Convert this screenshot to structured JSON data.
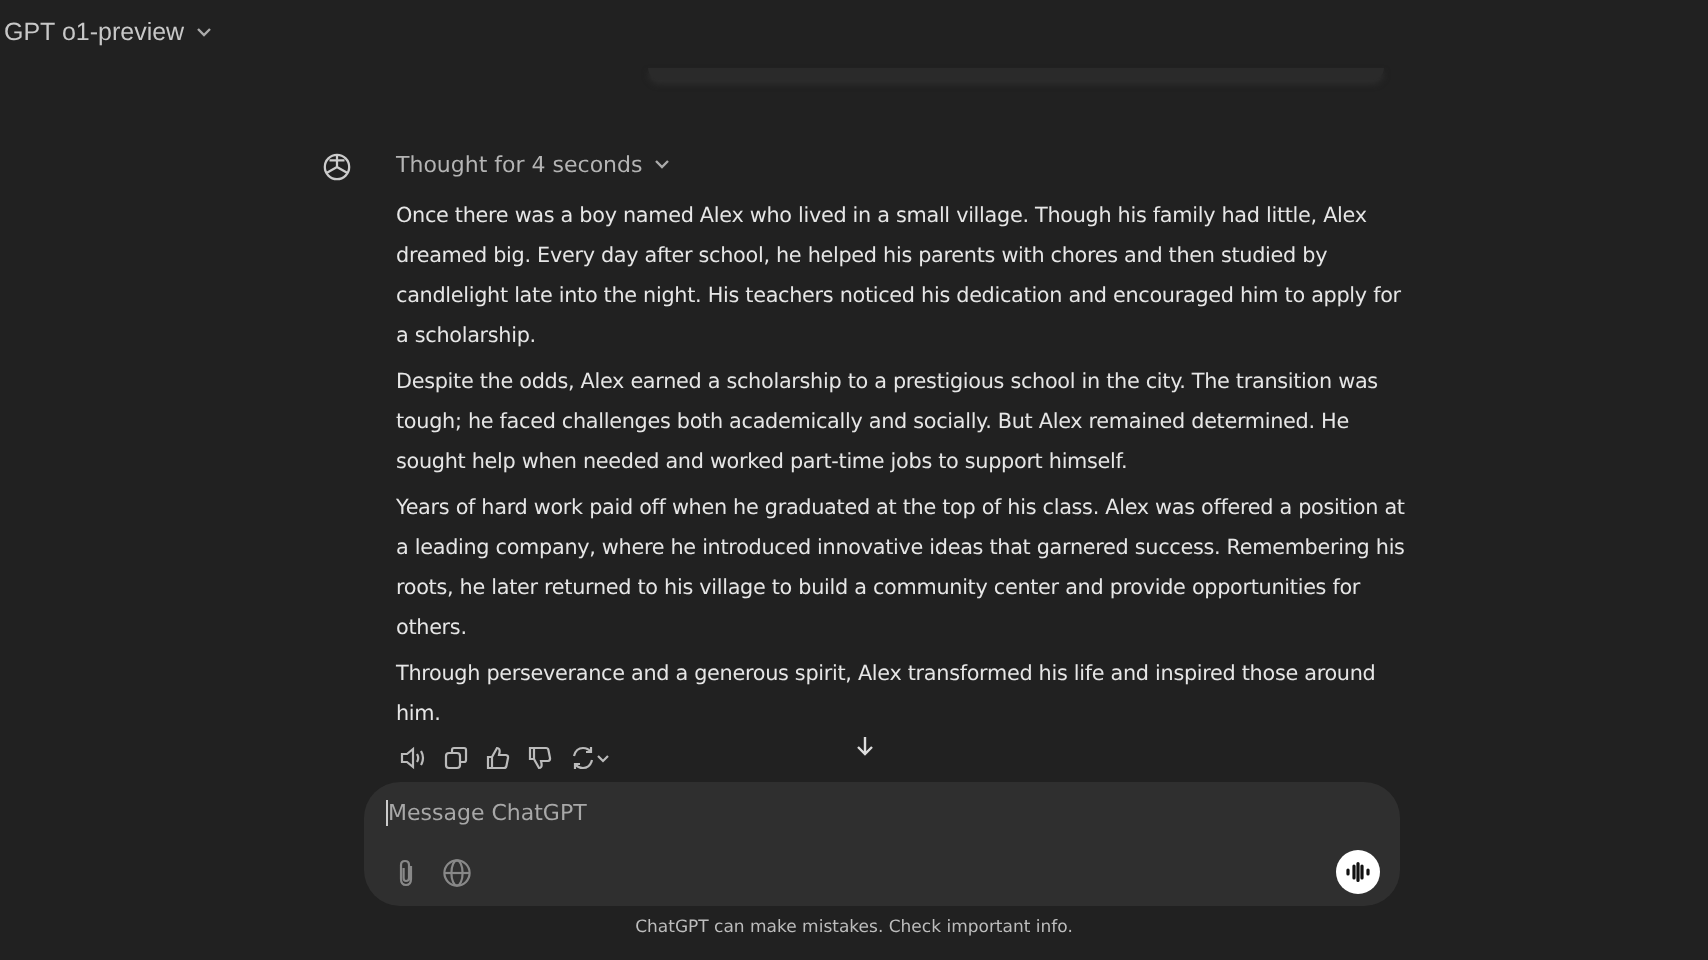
{
  "header": {
    "model": "GPT o1-preview"
  },
  "message": {
    "thought": "Thought for 4 seconds",
    "paragraphs": [
      "Once there was a boy named Alex who lived in a small village. Though his family had little, Alex dreamed big. Every day after school, he helped his parents with chores and then studied by candlelight late into the night. His teachers noticed his dedication and encouraged him to apply for a scholarship.",
      "Despite the odds, Alex earned a scholarship to a prestigious school in the city. The transition was tough; he faced challenges both academically and socially. But Alex remained determined. He sought help when needed and worked part-time jobs to support himself.",
      "Years of hard work paid off when he graduated at the top of his class. Alex was offered a position at a leading company, where he introduced innovative ideas that garnered success. Remembering his roots, he later returned to his village to build a community center and provide opportunities for others.",
      "Through perseverance and a generous spirit, Alex transformed his life and inspired those around him."
    ]
  },
  "composer": {
    "placeholder": "Message ChatGPT"
  },
  "footer": "ChatGPT can make mistakes. Check important info."
}
